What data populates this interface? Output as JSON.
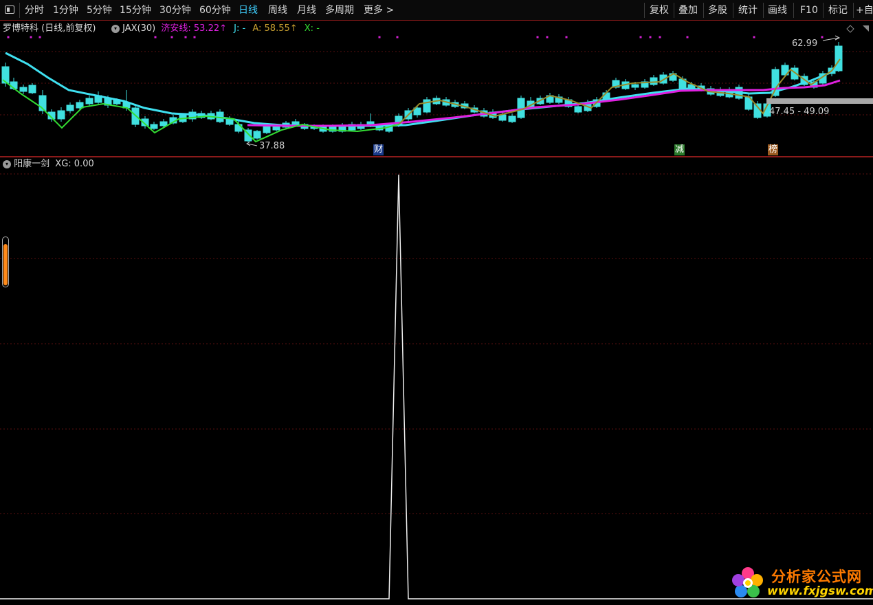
{
  "toolbar": {
    "window_icon": "window-icon",
    "periods": [
      "分时",
      "1分钟",
      "5分钟",
      "15分钟",
      "30分钟",
      "60分钟",
      "日线",
      "周线",
      "月线",
      "多周期",
      "更多 >"
    ],
    "active_period": "日线",
    "right_tools": [
      "复权",
      "叠加",
      "多股",
      "统计",
      "画线",
      "F10",
      "标记",
      "+自"
    ]
  },
  "main_panel": {
    "stock_title": "罗博特科 (日线,前复权)",
    "indicator_name": "JAX(30)",
    "jiaan_label": "济安线:",
    "jiaan_value": "53.22↑",
    "j_label": "J: -",
    "a_label": "A:",
    "a_value": "58.55↑",
    "x_label": "X: -",
    "high_price": "62.99",
    "low_price": "37.88",
    "range_label": "47.45 - 49.09",
    "tags": [
      "财",
      "减",
      "榜"
    ],
    "colors": {
      "line_cyan": "#3fe0f0",
      "line_green": "#33dd33",
      "line_olive": "#9a8a2a",
      "line_magenta": "#e020e0",
      "up_candle": "#ff3b3b",
      "down_candle": "#40e0e0"
    }
  },
  "sub_panel": {
    "label": "阳康一剑",
    "xg_text": "XG: 0.00"
  },
  "watermark": {
    "title": "分析家公式网",
    "url": "www.fxjgsw.com"
  }
}
